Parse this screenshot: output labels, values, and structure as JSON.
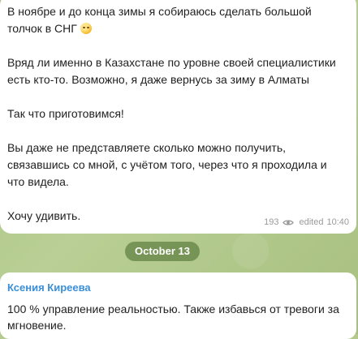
{
  "messages": [
    {
      "lines": [
        "В ноябре и до конца зимы я собираюсь сделать большой",
        "толчок в СНГ",
        "",
        "Вряд ли именно в Казахстане по уровне своей специалистики",
        "есть кто-то. Возможно, я даже вернусь за зиму в Алматы",
        "",
        "Так что приготовимся!",
        "",
        "Вы даже не представляете сколько можно получить,",
        "связавшись со мной, с учётом того, через что я проходила и",
        "что видела.",
        "",
        "Хочу удивить."
      ],
      "views": "193",
      "edited_label": "edited",
      "time": "10:40",
      "emoji": "relieved-face-emoji"
    },
    {
      "sender": "Ксения Киреева",
      "lines": [
        "100 % управление реальностью. Также избавься от тревоги за",
        "мгновение."
      ]
    }
  ],
  "date_separator": "October 13",
  "colors": {
    "chat_background": "#b5c98e",
    "bubble_background": "#ffffff",
    "sender_name": "#3a8fd8",
    "date_pill": "#5e7f40"
  }
}
